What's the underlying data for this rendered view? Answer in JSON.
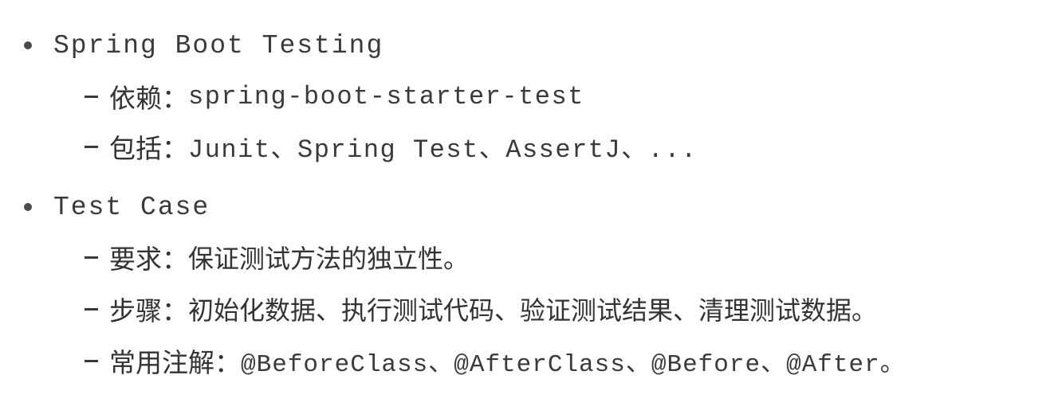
{
  "sections": [
    {
      "title": "Spring Boot Testing",
      "items": [
        {
          "label": "依赖：",
          "value": "spring-boot-starter-test"
        },
        {
          "label": "包括：",
          "value": "Junit、Spring Test、AssertJ、..."
        }
      ]
    },
    {
      "title": "Test Case",
      "items": [
        {
          "label": "要求：",
          "value": "保证测试方法的独立性。"
        },
        {
          "label": "步骤：",
          "value": "初始化数据、执行测试代码、验证测试结果、清理测试数据。"
        },
        {
          "label": "常用注解：",
          "value": "@BeforeClass、@AfterClass、@Before、@After。"
        }
      ]
    }
  ]
}
